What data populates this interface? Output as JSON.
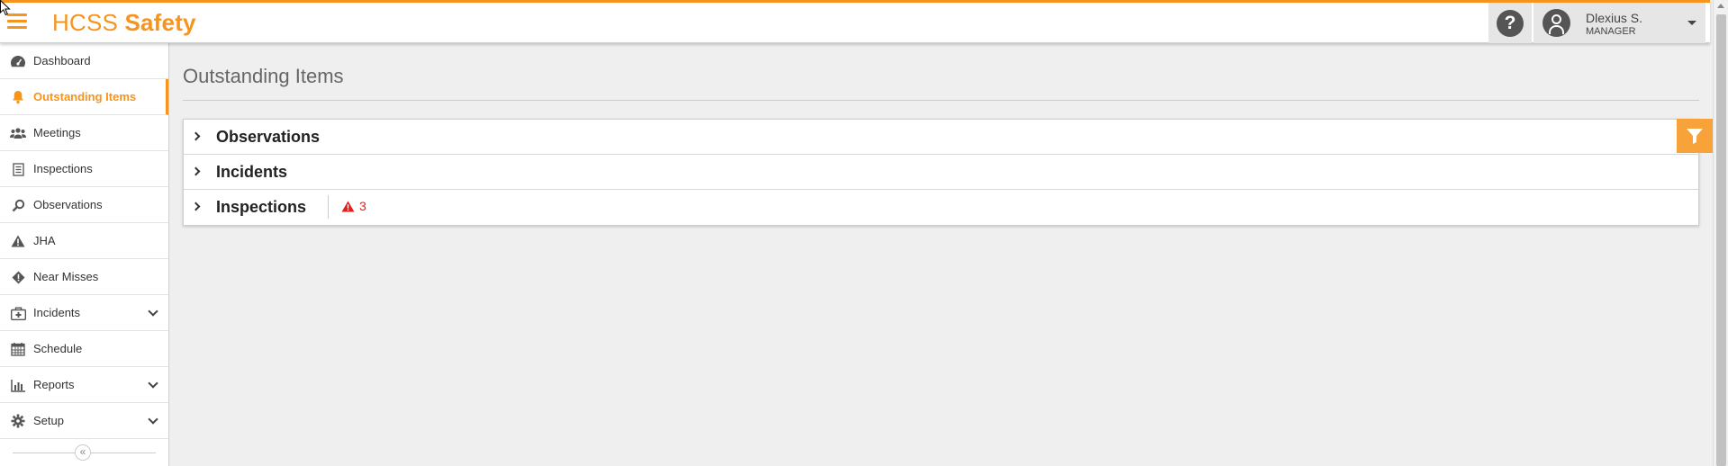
{
  "app": {
    "brand_prefix": "HCSS",
    "brand_suffix": "Safety"
  },
  "user": {
    "name": "Dlexius S.",
    "role": "MANAGER"
  },
  "sidebar": {
    "items": [
      {
        "label": "Dashboard",
        "icon": "dashboard-icon"
      },
      {
        "label": "Outstanding Items",
        "icon": "bell-icon",
        "active": true
      },
      {
        "label": "Meetings",
        "icon": "users-icon"
      },
      {
        "label": "Inspections",
        "icon": "clipboard-icon"
      },
      {
        "label": "Observations",
        "icon": "search-icon"
      },
      {
        "label": "JHA",
        "icon": "warning-icon"
      },
      {
        "label": "Near Misses",
        "icon": "diamond-alert-icon"
      },
      {
        "label": "Incidents",
        "icon": "medkit-icon",
        "expandable": true
      },
      {
        "label": "Schedule",
        "icon": "calendar-icon"
      },
      {
        "label": "Reports",
        "icon": "bar-chart-icon",
        "expandable": true
      },
      {
        "label": "Setup",
        "icon": "gear-icon",
        "expandable": true
      }
    ],
    "collapse_glyph": "«"
  },
  "main": {
    "title": "Outstanding Items",
    "panels": [
      {
        "title": "Observations"
      },
      {
        "title": "Incidents"
      },
      {
        "title": "Inspections",
        "alert_count": "3"
      }
    ]
  },
  "colors": {
    "accent": "#f7941d",
    "alert": "#e02020",
    "filter_button": "#f8a33a"
  }
}
